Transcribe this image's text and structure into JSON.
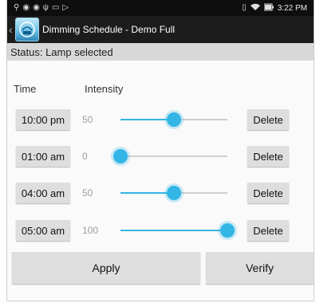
{
  "status_bar": {
    "left_icons": [
      "location-icon",
      "instagram-icon",
      "instagram-icon",
      "usb-icon",
      "screen-icon",
      "media-icon"
    ],
    "right_icons": [
      "vibrate-icon",
      "wifi-icon",
      "battery-icon"
    ],
    "time": "3:22 PM"
  },
  "action_bar": {
    "title": "Dimming Schedule - Demo Full",
    "app_icon": "lamp-app-icon"
  },
  "status": "Status: Lamp selected",
  "headers": {
    "time": "Time",
    "intensity": "Intensity"
  },
  "rows": [
    {
      "time": "10:00 pm",
      "intensity": "50",
      "level": 50,
      "delete": "Delete"
    },
    {
      "time": "01:00 am",
      "intensity": "0",
      "level": 0,
      "delete": "Delete"
    },
    {
      "time": "04:00 am",
      "intensity": "50",
      "level": 50,
      "delete": "Delete"
    },
    {
      "time": "05:00 am",
      "intensity": "100",
      "level": 100,
      "delete": "Delete"
    }
  ],
  "actions": {
    "apply": "Apply",
    "verify": "Verify"
  },
  "colors": {
    "accent": "#33b5e5",
    "actionbar": "#1c1c1c",
    "statusline": "#d8d8d8"
  }
}
